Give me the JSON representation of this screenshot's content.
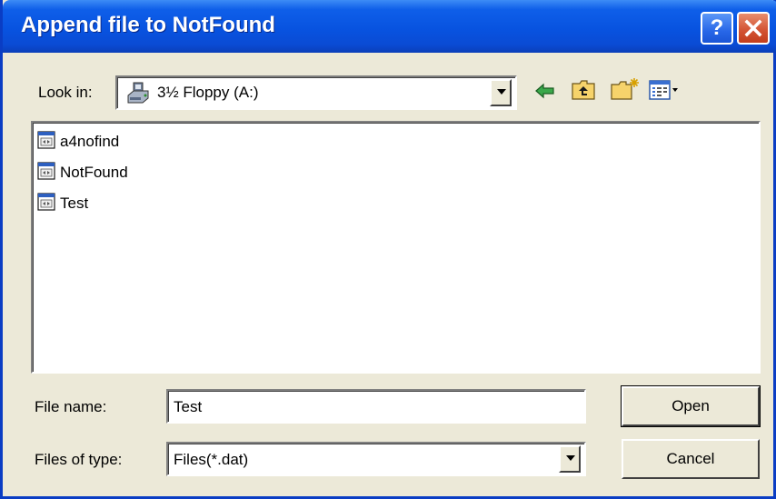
{
  "window": {
    "title": "Append file to NotFound",
    "help_label": "?",
    "close_label": "close"
  },
  "look_in": {
    "label": "Look in:",
    "value": "3½ Floppy (A:)",
    "icon": "floppy-drive-icon"
  },
  "toolbar": {
    "back_icon": "back-arrow-icon",
    "up_icon": "up-folder-icon",
    "new_folder_icon": "new-folder-icon",
    "view_menu_icon": "view-menu-icon"
  },
  "files": [
    {
      "name": "a4nofind",
      "icon": "dat-file-icon"
    },
    {
      "name": "NotFound",
      "icon": "dat-file-icon"
    },
    {
      "name": "Test",
      "icon": "dat-file-icon"
    }
  ],
  "file_name": {
    "label": "File name:",
    "value": "Test"
  },
  "file_type": {
    "label": "Files of type:",
    "value": "Files(*.dat)"
  },
  "buttons": {
    "open": "Open",
    "cancel": "Cancel"
  },
  "colors": {
    "titlebar": "#0853e0",
    "dialog_bg": "#ece9d8",
    "close_button": "#d45535"
  }
}
